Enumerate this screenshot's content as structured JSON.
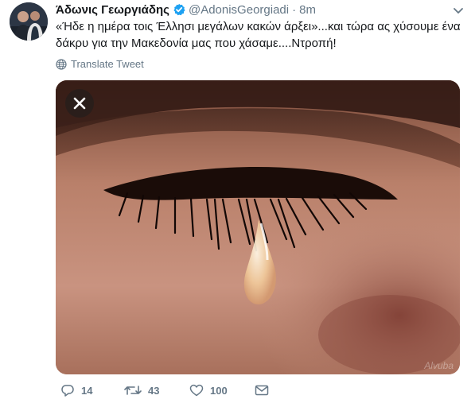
{
  "user": {
    "display_name": "Άδωνις Γεωργιάδης",
    "handle": "@AdonisGeorgiadi",
    "separator": "·",
    "time": "8m",
    "verified": true
  },
  "tweet": {
    "text": "«Ήδε η ημέρα τοις Έλλησι μεγάλων κακών άρξει»...και τώρα ας χύσουμε ένα δάκρυ για την Μακεδονία μας που χάσαμε....Ντροπή!",
    "translate_label": "Translate Tweet"
  },
  "media": {
    "watermark": "Alvuba"
  },
  "actions": {
    "replies": "14",
    "retweets": "43",
    "likes": "100"
  },
  "colors": {
    "verified": "#1da1f2",
    "muted": "#657786",
    "text": "#14171a"
  },
  "icons": [
    "verified-badge-icon",
    "chevron-down-icon",
    "globe-icon",
    "close-icon",
    "reply-icon",
    "retweet-icon",
    "like-icon",
    "direct-message-icon"
  ]
}
